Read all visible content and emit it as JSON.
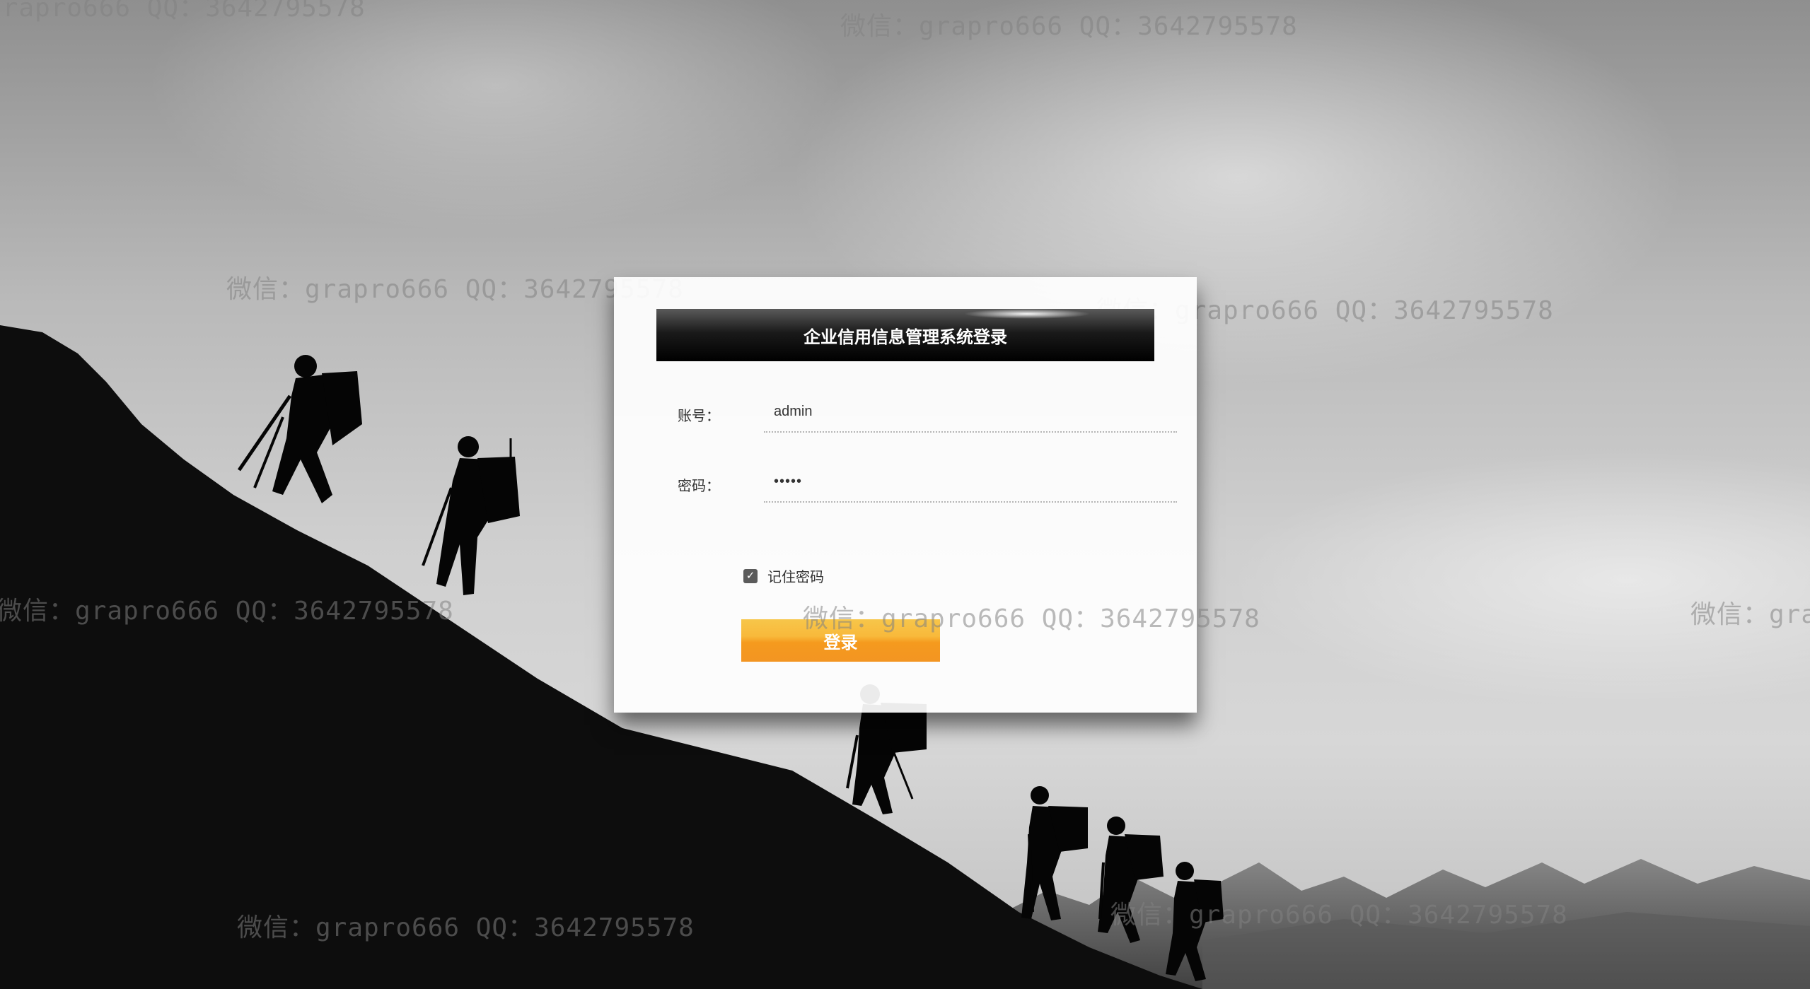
{
  "watermark": {
    "text": "微信：grapro666 QQ：3642795578"
  },
  "login": {
    "title": "企业信用信息管理系统登录",
    "account_label": "账号：",
    "account_value": "admin",
    "password_label": "密码：",
    "password_value": "•••••",
    "remember_label": "记住密码",
    "remember_checked": true,
    "submit_label": "登录"
  },
  "colors": {
    "button_orange": "#f59a1e",
    "header_black": "#000000"
  }
}
